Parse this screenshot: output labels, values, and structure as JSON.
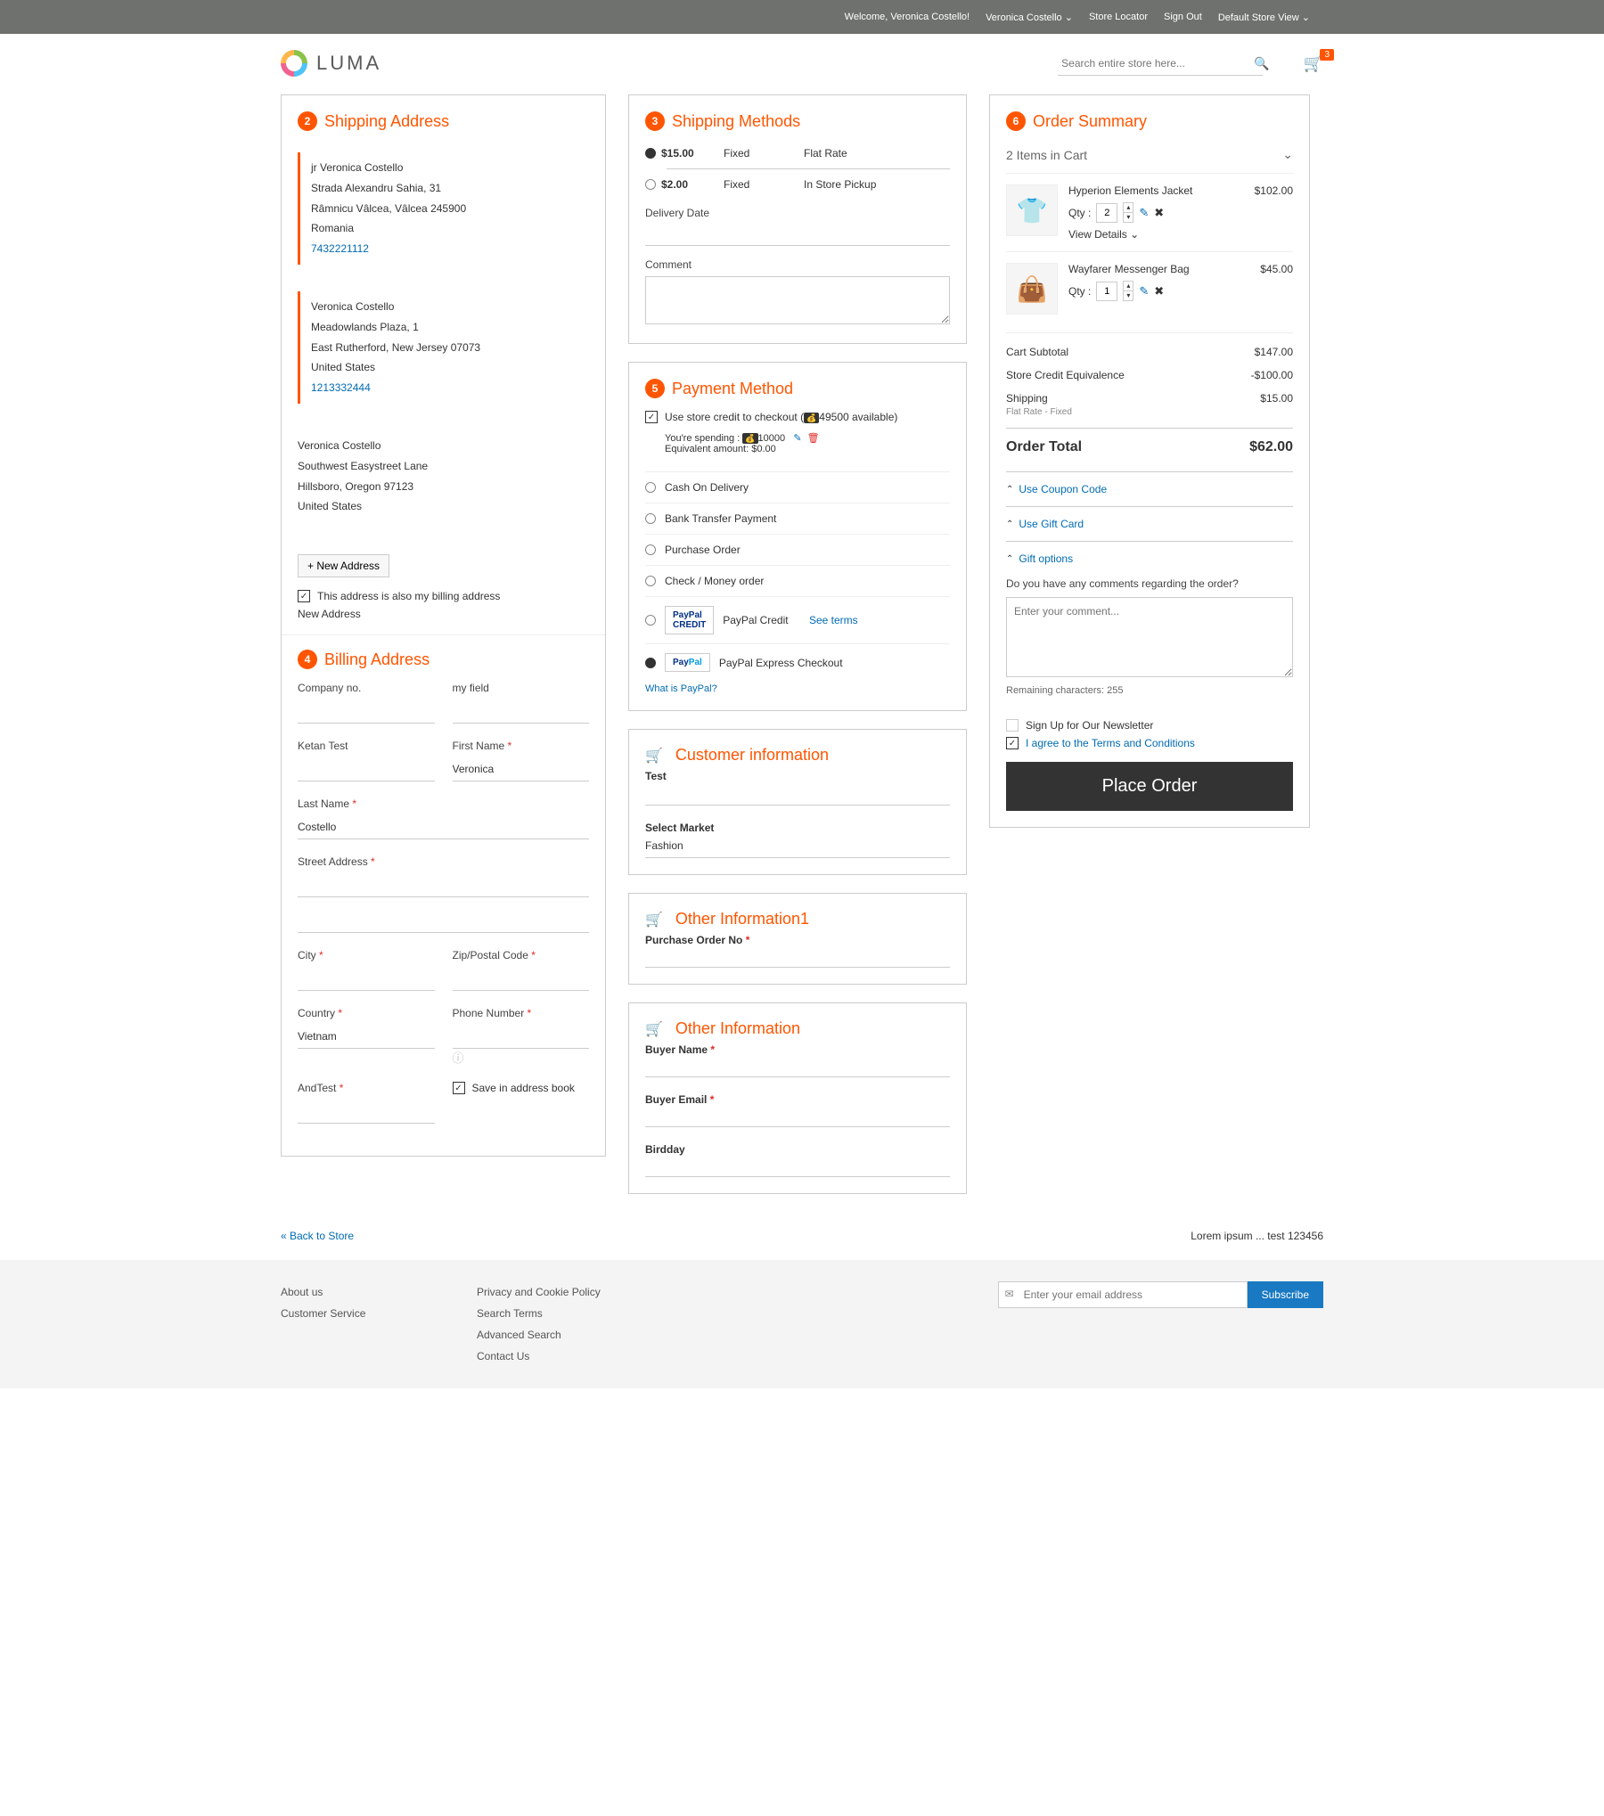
{
  "topbar": {
    "welcome": "Welcome, Veronica Costello!",
    "account": "Veronica Costello",
    "storeLocator": "Store Locator",
    "signOut": "Sign Out",
    "storeView": "Default Store View"
  },
  "header": {
    "brand": "LUMA",
    "searchPlaceholder": "Search entire store here...",
    "cartCount": "3"
  },
  "steps": {
    "shippingAddress": {
      "num": "2",
      "title": "Shipping Address",
      "newAddress": "+ New Address",
      "alsoBilling": "This address is also my billing address",
      "newAddressLink": "New Address",
      "addresses": [
        {
          "name": "jr Veronica Costello",
          "line1": "Strada Alexandru Sahia, 31",
          "line2": "Râmnicu Vâlcea, Vâlcea 245900",
          "country": "Romania",
          "phone": "7432221112",
          "selected": true
        },
        {
          "name": "Veronica Costello",
          "line1": "Meadowlands Plaza, 1",
          "line2": "East Rutherford, New Jersey 07073",
          "country": "United States",
          "phone": "1213332444",
          "selected": true
        },
        {
          "name": "Veronica Costello",
          "line1": "Southwest Easystreet Lane",
          "line2": "Hillsboro, Oregon 97123",
          "country": "United States",
          "phone": "",
          "selected": false
        }
      ]
    },
    "billing": {
      "num": "4",
      "title": "Billing Address",
      "fields": {
        "companyNo": "Company no.",
        "myField": "my field",
        "ketanTest": "Ketan Test",
        "firstName": "First Name",
        "firstNameVal": "Veronica",
        "lastName": "Last Name",
        "lastNameVal": "Costello",
        "street": "Street Address",
        "city": "City",
        "zip": "Zip/Postal Code",
        "country": "Country",
        "countryVal": "Vietnam",
        "phone": "Phone Number",
        "andTest": "AndTest",
        "save": "Save in address book"
      }
    },
    "shipMethods": {
      "num": "3",
      "title": "Shipping Methods",
      "delivery": "Delivery Date",
      "comment": "Comment",
      "rows": [
        {
          "price": "$15.00",
          "type": "Fixed",
          "name": "Flat Rate",
          "sel": true
        },
        {
          "price": "$2.00",
          "type": "Fixed",
          "name": "In Store Pickup",
          "sel": false
        }
      ]
    },
    "payment": {
      "num": "5",
      "title": "Payment Method",
      "useCredit": "Use store credit to checkout (",
      "creditAvail": "49500 available)",
      "spending": "You're spending : ",
      "spendVal": "10000",
      "equiv": "Equivalent amount: $0.00",
      "whatPaypal": "What is PayPal?",
      "seeTerms": "See terms",
      "methods": [
        "Cash On Delivery",
        "Bank Transfer Payment",
        "Purchase Order",
        "Check / Money order"
      ],
      "paypalCredit": "PayPal Credit",
      "paypalExpress": "PayPal Express Checkout"
    },
    "custInfo": {
      "title": "Customer information",
      "test": "Test",
      "selectMarket": "Select Market",
      "fashion": "Fashion"
    },
    "other1": {
      "title": "Other Information1",
      "po": "Purchase Order No"
    },
    "other2": {
      "title": "Other Information",
      "buyerName": "Buyer Name",
      "buyerEmail": "Buyer Email",
      "birdday": "Birdday"
    }
  },
  "summary": {
    "num": "6",
    "title": "Order Summary",
    "itemsInCart": "2 Items in Cart",
    "items": [
      {
        "name": "Hyperion Elements Jacket",
        "price": "$102.00",
        "qty": "2",
        "details": "View Details"
      },
      {
        "name": "Wayfarer Messenger Bag",
        "price": "$45.00",
        "qty": "1",
        "details": ""
      }
    ],
    "qtyLabel": "Qty :",
    "totals": {
      "subtotal": "Cart Subtotal",
      "subtotalV": "$147.00",
      "creditEq": "Store Credit Equivalence",
      "creditEqV": "-$100.00",
      "shipping": "Shipping",
      "shippingSub": "Flat Rate - Fixed",
      "shippingV": "$15.00",
      "orderTotal": "Order Total",
      "orderTotalV": "$62.00"
    },
    "coupon": "Use Coupon Code",
    "giftCard": "Use Gift Card",
    "giftOptions": "Gift options",
    "giftQ": "Do you have any comments regarding the order?",
    "giftPlaceholder": "Enter your comment...",
    "remaining": "Remaining characters: 255",
    "newsletter": "Sign Up for Our Newsletter",
    "terms": "I agree to the Terms and Conditions",
    "placeOrder": "Place Order"
  },
  "below": {
    "back": "« Back to Store",
    "lorem": "Lorem ipsum ... test 123456"
  },
  "footer": {
    "col1": [
      "About us",
      "Customer Service"
    ],
    "col2": [
      "Privacy and Cookie Policy",
      "Search Terms",
      "Advanced Search",
      "Contact Us"
    ],
    "subPlaceholder": "Enter your email address",
    "subscribe": "Subscribe"
  }
}
